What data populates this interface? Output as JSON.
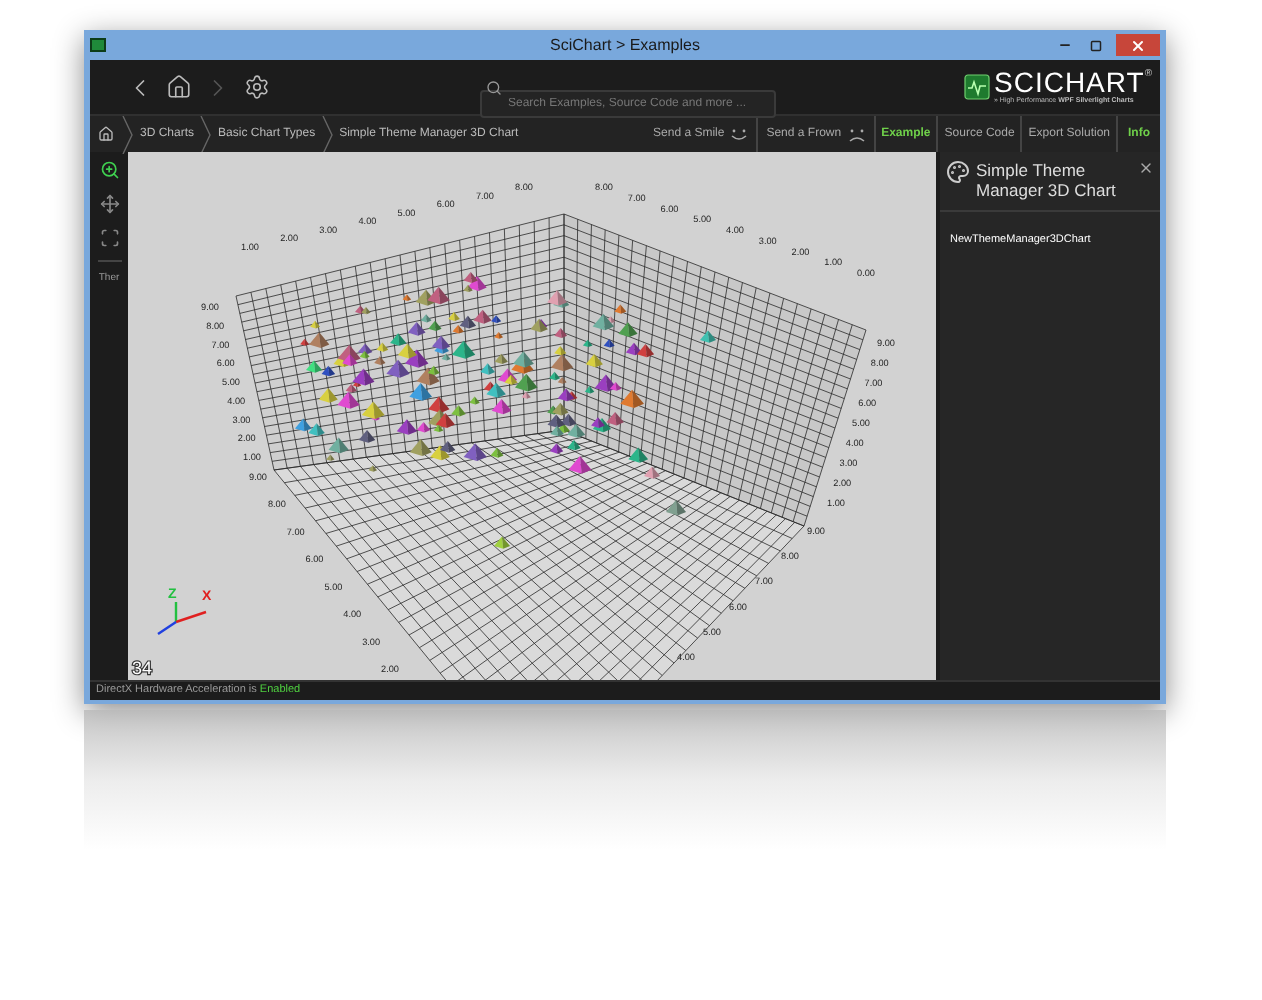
{
  "window": {
    "title": "SciChart > Examples"
  },
  "search": {
    "placeholder": "Search Examples, Source Code and more ..."
  },
  "logo": {
    "name": "SCICHART",
    "mark": "®",
    "tagline": "» High Performance **WPF Silverlight Charts**"
  },
  "breadcrumbs": [
    "3D Charts",
    "Basic Chart Types",
    "Simple Theme Manager 3D Chart"
  ],
  "feedback": [
    {
      "label": "Send a Smile",
      "kind": "smile"
    },
    {
      "label": "Send a Frown",
      "kind": "frown"
    }
  ],
  "view_tabs": [
    {
      "label": "Example",
      "selected": true
    },
    {
      "label": "Source Code",
      "selected": false
    },
    {
      "label": "Export Solution",
      "selected": false
    }
  ],
  "info_button": {
    "label": "Info",
    "selected": true
  },
  "tools": [
    {
      "kind": "zoom",
      "selected": true
    },
    {
      "kind": "pan",
      "selected": false
    },
    {
      "kind": "fit",
      "selected": false
    }
  ],
  "theme_button": "Ther",
  "chart": {
    "tick_groups": [
      [
        "1.00",
        "2.00",
        "3.00",
        "4.00",
        "5.00",
        "6.00",
        "7.00",
        "8.00"
      ],
      [
        "8.00",
        "7.00",
        "6.00",
        "5.00",
        "4.00",
        "3.00",
        "2.00",
        "1.00",
        "0.00"
      ],
      [
        "9.00",
        "8.00",
        "7.00",
        "6.00",
        "5.00",
        "4.00",
        "3.00",
        "2.00",
        "1.00"
      ],
      [
        "9.00",
        "8.00",
        "7.00",
        "6.00",
        "5.00",
        "4.00",
        "3.00",
        "2.00"
      ],
      [
        "9.00",
        "8.00",
        "7.00",
        "6.00",
        "5.00",
        "4.00",
        "3.00",
        "2.00",
        "1.00"
      ],
      [
        "9.00",
        "8.00",
        "7.00",
        "6.00",
        "5.00",
        "4.00"
      ]
    ],
    "axis_letters": [
      "Z",
      "X"
    ],
    "fps": "34"
  },
  "info_panel": {
    "title": "Simple Theme Manager 3D Chart",
    "items": [
      "NewThemeManager3DChart"
    ]
  },
  "status": {
    "text": "DirectX Hardware Acceleration is ",
    "state": "Enabled"
  }
}
